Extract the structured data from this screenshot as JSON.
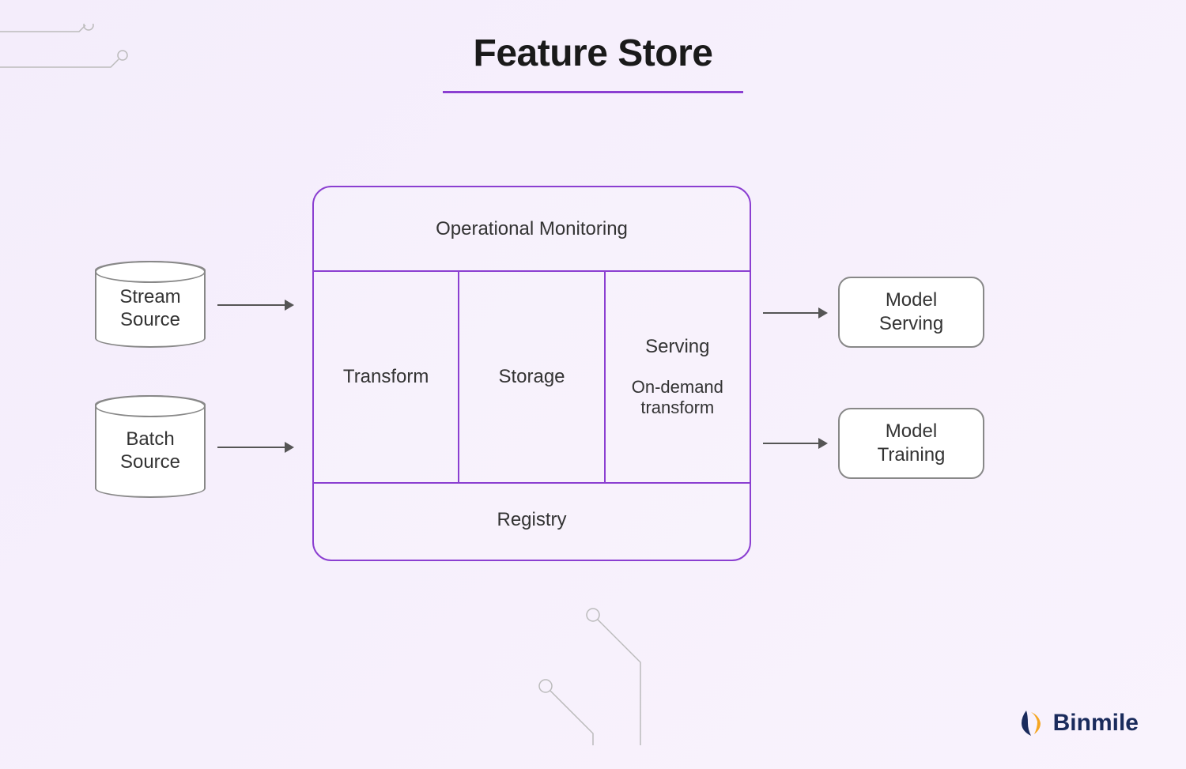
{
  "title": "Feature Store",
  "sources": {
    "stream": "Stream\nSource",
    "batch": "Batch\nSource"
  },
  "core": {
    "top": "Operational Monitoring",
    "cols": {
      "transform": "Transform",
      "storage": "Storage",
      "serving": "Serving",
      "onDemand": "On-demand\ntransform"
    },
    "bottom": "Registry"
  },
  "outputs": {
    "serving": "Model\nServing",
    "training": "Model\nTraining"
  },
  "brand": "Binmile"
}
